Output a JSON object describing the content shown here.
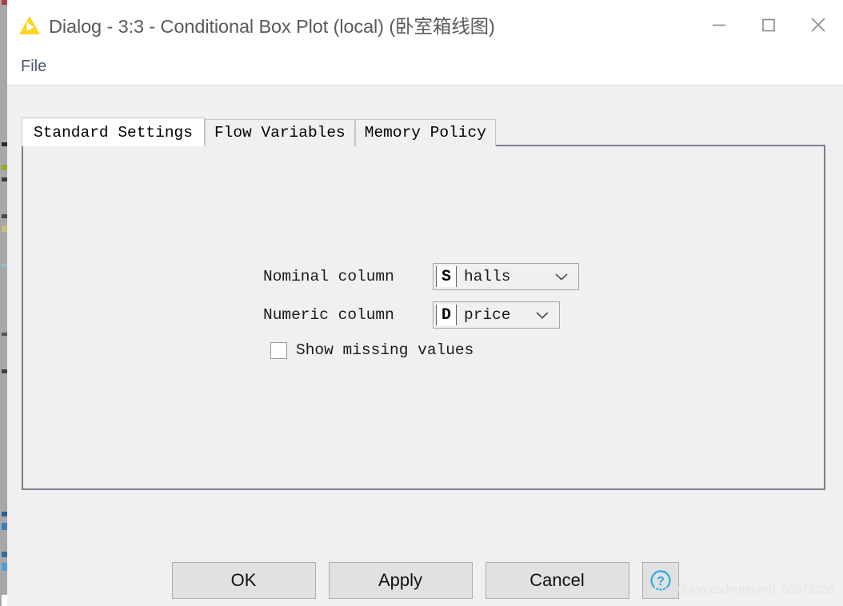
{
  "window": {
    "title": "Dialog - 3:3 - Conditional Box Plot (local) (卧室箱线图)",
    "icon": "knime-triangle-icon",
    "controls": {
      "minimize": "minimize-icon",
      "maximize": "maximize-icon",
      "close": "close-icon"
    }
  },
  "menu": {
    "items": [
      {
        "label": "File"
      }
    ]
  },
  "tabs": [
    {
      "label": "Standard Settings",
      "active": true
    },
    {
      "label": "Flow Variables",
      "active": false
    },
    {
      "label": "Memory Policy",
      "active": false
    }
  ],
  "form": {
    "rows": [
      {
        "label": "Nominal column",
        "badge": "S",
        "value": "halls",
        "arrow": "chevron-down-icon"
      },
      {
        "label": "Numeric column",
        "badge": "D",
        "value": "price",
        "arrow": "chevron-down-icon"
      }
    ],
    "checkbox": {
      "label": "Show missing values",
      "checked": false
    }
  },
  "buttons": {
    "ok": "OK",
    "apply": "Apply",
    "cancel": "Cancel",
    "help": "help-icon"
  },
  "watermark": "https://blog.csdn.net/m0_56072336",
  "colors": {
    "accent_icon": "#FFD51E",
    "help_blue": "#29ABE2",
    "panel_border": "#787E8C",
    "dialog_bg": "#F0F0F0",
    "title_text": "#5A5A5A",
    "menu_text": "#4A5A72"
  }
}
